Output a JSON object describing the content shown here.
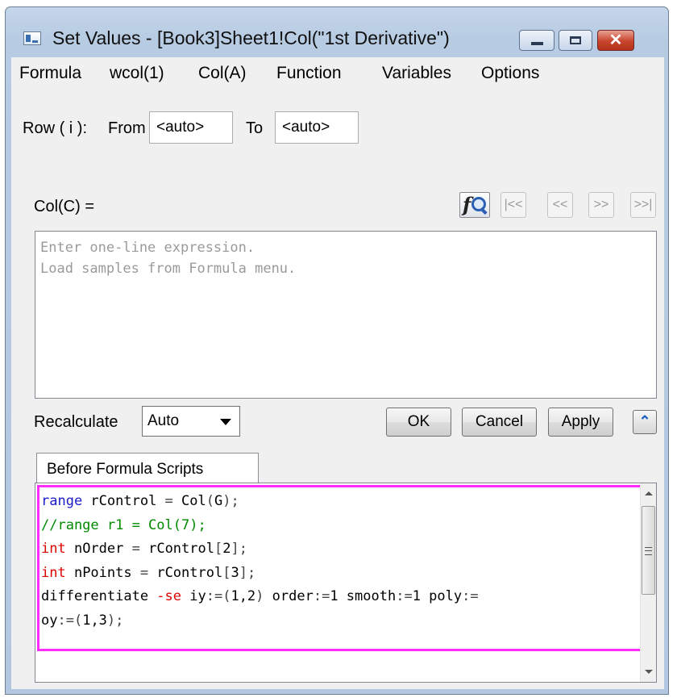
{
  "window": {
    "title": "Set Values - [Book3]Sheet1!Col(\"1st Derivative\")"
  },
  "menu": [
    "Formula",
    "wcol(1)",
    "Col(A)",
    "Function",
    "Variables",
    "Options"
  ],
  "row_range": {
    "label": "Row ( i ):",
    "from_label": "From",
    "from_value": "<auto>",
    "to_label": "To",
    "to_value": "<auto>"
  },
  "column": {
    "label": "Col(C) =",
    "nav_buttons": [
      "|<<",
      "<<",
      ">>",
      ">>|"
    ],
    "expression_placeholder": [
      "Enter one-line expression.",
      "Load samples from Formula menu."
    ]
  },
  "recalculate": {
    "label": "Recalculate",
    "value": "Auto"
  },
  "buttons": {
    "ok": "OK",
    "cancel": "Cancel",
    "apply": "Apply",
    "collapse": "⌃"
  },
  "scripts": {
    "tab_label": "Before Formula Scripts",
    "lines": [
      "range rControl = Col(G);",
      "//range r1 = Col(7);",
      "int nOrder = rControl[2];",
      "int nPoints = rControl[3];",
      "differentiate -se iy:=(1,2) order:=1 smooth:=1 poly:=",
      "oy:=(1,3);"
    ]
  },
  "colors": {
    "highlight_border": "#ff2bff",
    "keyword_blue": "#1a1acc",
    "keyword_red": "#dd0000",
    "comment_green": "#008a00"
  }
}
